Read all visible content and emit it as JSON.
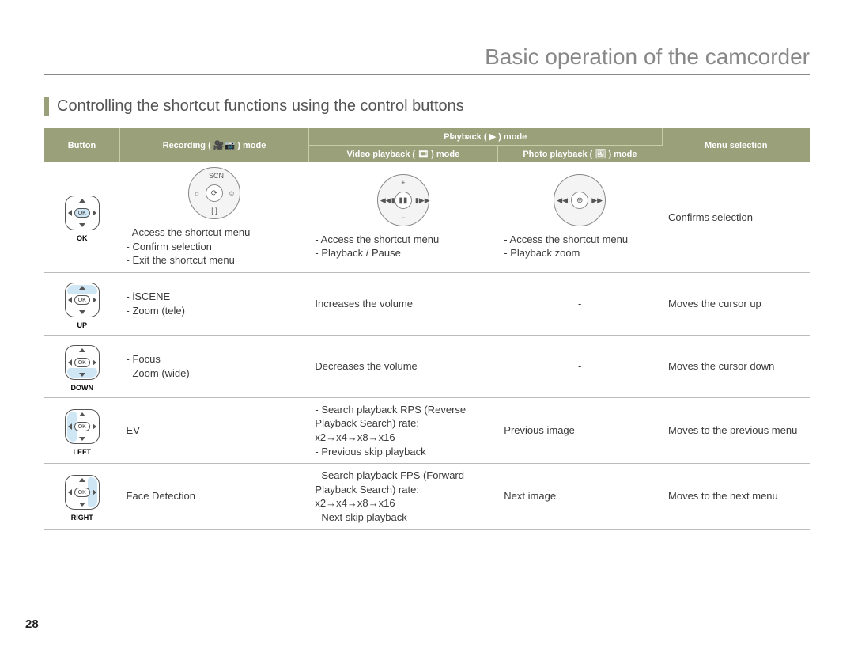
{
  "page_number": "28",
  "page_title": "Basic operation of the camcorder",
  "section_title": "Controlling the shortcut functions using the control buttons",
  "headers": {
    "button": "Button",
    "recording": "Recording (",
    "recording_suffix": ") mode",
    "playback": "Playback (",
    "playback_suffix": ") mode",
    "video_playback": "Video playback (",
    "video_playback_suffix": ") mode",
    "photo_playback": "Photo playback (",
    "photo_playback_suffix": ") mode",
    "menu_selection": "Menu selection"
  },
  "rows": [
    {
      "button_label": "OK",
      "recording": "- Access the shortcut menu\n- Confirm selection\n- Exit the shortcut menu",
      "video": "- Access the shortcut menu\n- Playback / Pause",
      "photo": "- Access the shortcut menu\n- Playback zoom",
      "menu": "Confirms selection"
    },
    {
      "button_label": "UP",
      "recording": "- iSCENE\n- Zoom (tele)",
      "video": "Increases the volume",
      "photo": "-",
      "menu": "Moves the cursor up"
    },
    {
      "button_label": "DOWN",
      "recording": "- Focus\n- Zoom (wide)",
      "video": "Decreases the volume",
      "photo": "-",
      "menu": "Moves the cursor down"
    },
    {
      "button_label": "LEFT",
      "recording": "EV",
      "video": "- Search playback RPS (Reverse Playback Search) rate:\n  x2→x4→x8→x16\n- Previous skip playback",
      "photo": "Previous image",
      "menu": "Moves to the previous menu"
    },
    {
      "button_label": "RIGHT",
      "recording": "Face Detection",
      "video": "- Search playback FPS (Forward Playback Search) rate:\n  x2→x4→x8→x16\n- Next skip playback",
      "photo": "Next image",
      "menu": "Moves to the next menu"
    }
  ],
  "icons": {
    "pad_ok": "OK",
    "rnd_vid_ctr": "▮▮",
    "rnd_vid_top": "+",
    "rnd_vid_bot": "−",
    "rnd_vid_l": "◀◀▮",
    "rnd_vid_r": "▮▶▶",
    "rnd_pho_ctr": "⊕",
    "rnd_pho_l": "◀◀",
    "rnd_pho_r": "▶▶",
    "rnd_rec_ctr": "⟳"
  }
}
